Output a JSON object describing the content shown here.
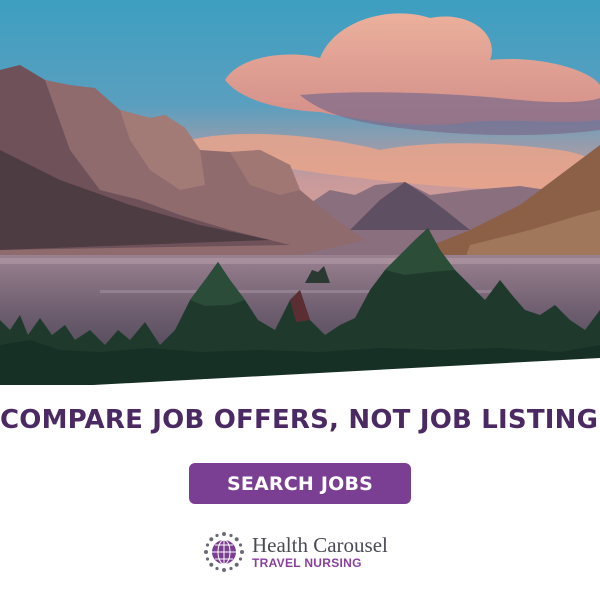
{
  "ad": {
    "headline": "COMPARE JOB OFFERS, NOT JOB LISTINGS.",
    "cta_label": "SEARCH JOBS",
    "brand_name": "Health Carousel",
    "brand_tagline": "TRAVEL NURSING"
  },
  "colors": {
    "headline": "#4b2a63",
    "button_bg": "#7a3e93",
    "button_text": "#ffffff",
    "brand_name": "#4a4a55",
    "brand_tagline": "#8a3fa0"
  },
  "icons": {
    "logo": "globe-carousel-icon"
  }
}
